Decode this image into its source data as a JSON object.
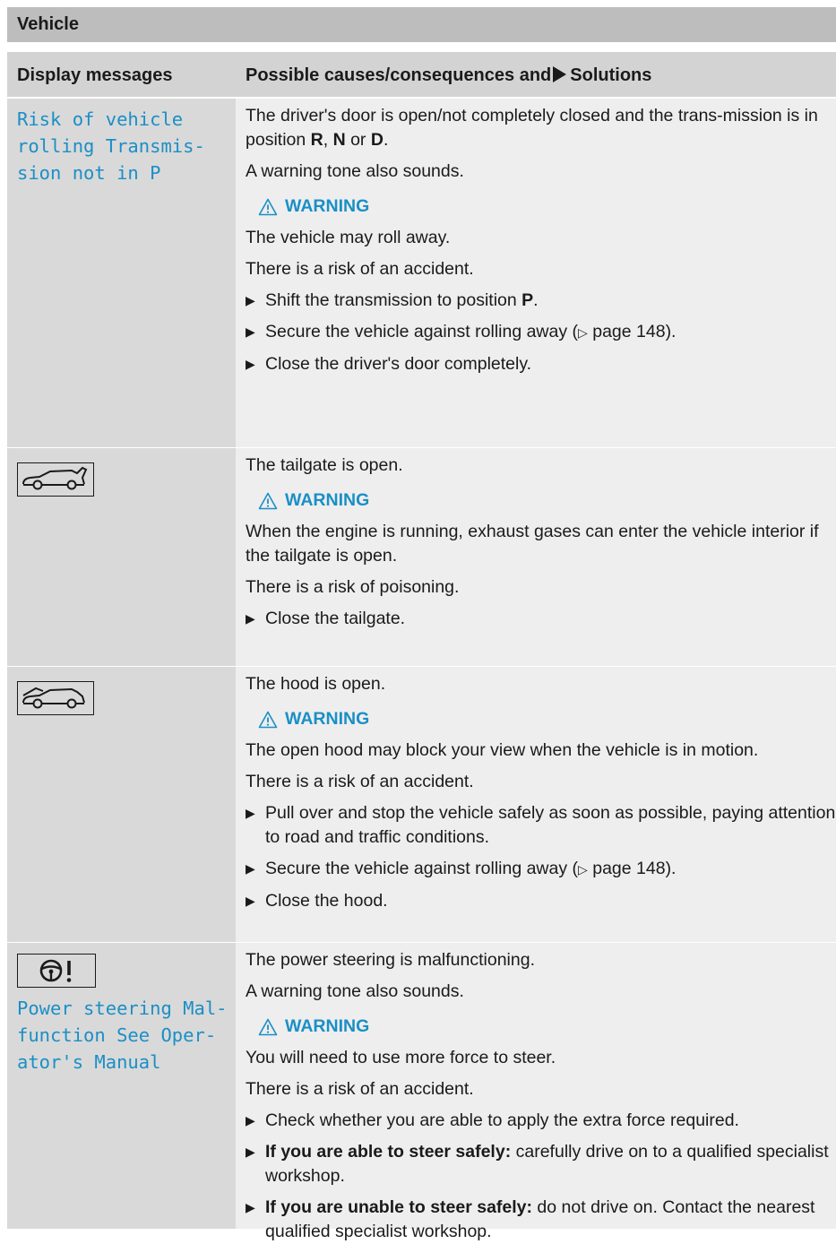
{
  "section_title": "Vehicle",
  "header": {
    "left": "Display messages",
    "right_before": "Possible causes/consequences and",
    "right_after": "Solutions"
  },
  "warning_label": "WARNING",
  "icons": [
    "tailgate-open-icon",
    "hood-open-icon",
    "power-steering-icon",
    "warning-triangle-icon",
    "arrow-bullet-icon"
  ],
  "colors": {
    "message": "#1a8fc6",
    "warning": "#1a8fc6",
    "header_bg": "#d3d3d3",
    "section_bg": "#bdbdbd"
  },
  "rows": [
    {
      "message": "Risk of vehicle\nrolling Transmis-\nsion not in P",
      "cause_a": "The driver's door is open/not completely closed and the trans-mission is in position ",
      "cause_R": "R",
      "cause_sep1": ", ",
      "cause_N": "N",
      "cause_sep2": " or ",
      "cause_D": "D",
      "cause_end": ".",
      "tone": "A warning tone also sounds.",
      "w1": "The vehicle may roll away.",
      "w2": "There is a risk of an accident.",
      "b1_text": "Shift the transmission to position ",
      "b1_bold": "P",
      "b1_end": ".",
      "b2_a": "Secure the vehicle against rolling away (",
      "b2_ref": "▷",
      "b2_b": " page 148).",
      "b3": "Close the driver's door completely."
    },
    {
      "cause": "The tailgate is open.",
      "w1": "When the engine is running, exhaust gases can enter the vehicle interior if the tailgate is open.",
      "w2": "There is a risk of poisoning.",
      "b1": "Close the tailgate."
    },
    {
      "cause": "The hood is open.",
      "w1": "The open hood may block your view when the vehicle is in motion.",
      "w2": "There is a risk of an accident.",
      "b1": "Pull over and stop the vehicle safely as soon as possible, paying attention to road and traffic conditions.",
      "b2_a": "Secure the vehicle against rolling away (",
      "b2_ref": "▷",
      "b2_b": " page 148).",
      "b3": "Close the hood."
    },
    {
      "message": "Power steering Mal-\nfunction See Oper-\nator's Manual",
      "cause": "The power steering is malfunctioning.",
      "tone": "A warning tone also sounds.",
      "w1": "You will need to use more force to steer.",
      "w2": "There is a risk of an accident.",
      "b1": "Check whether you are able to apply the extra force required.",
      "b2_bold": "If you are able to steer safely:",
      "b2_text": " carefully drive on to a qualified specialist workshop.",
      "b3_bold": "If you are unable to steer safely:",
      "b3_text": " do not drive on. Contact the nearest qualified specialist workshop."
    }
  ]
}
